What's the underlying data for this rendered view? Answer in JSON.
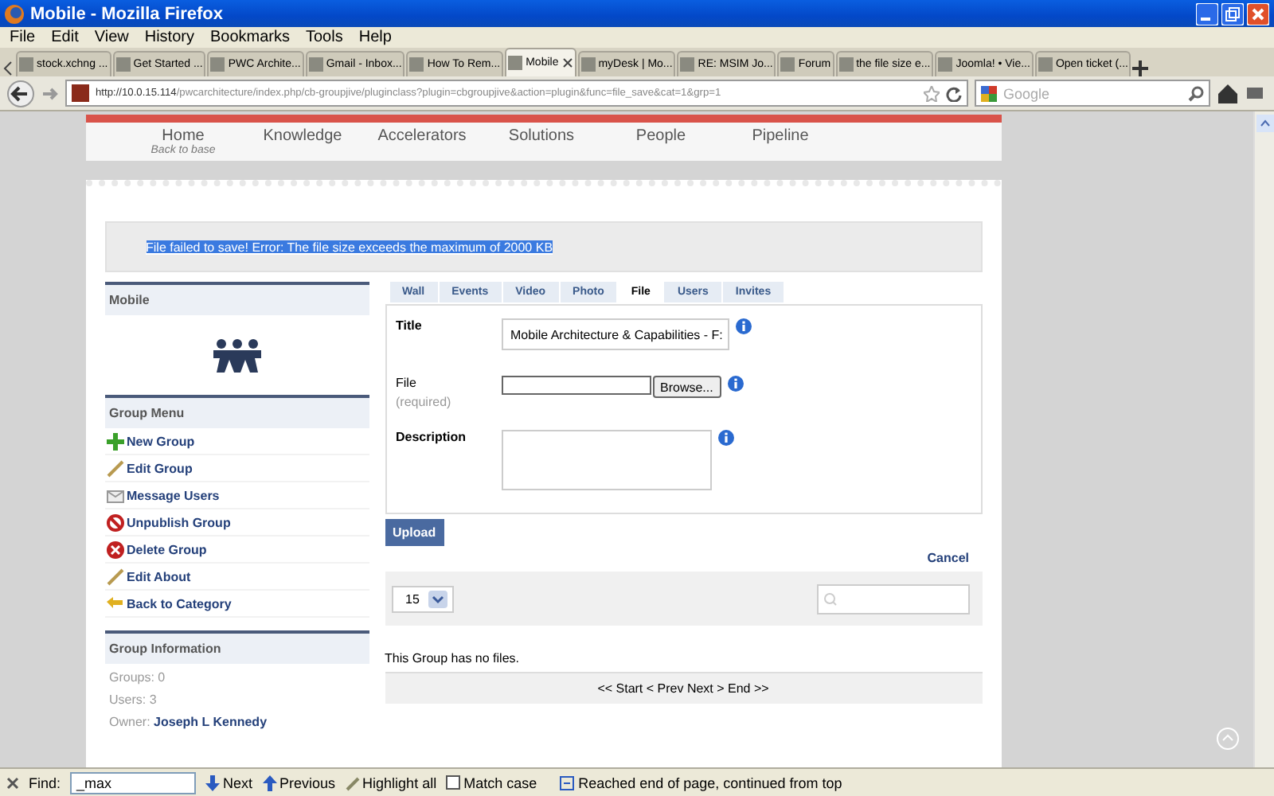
{
  "window": {
    "title": "Mobile - Mozilla Firefox"
  },
  "menu": [
    "File",
    "Edit",
    "View",
    "History",
    "Bookmarks",
    "Tools",
    "Help"
  ],
  "tabs": [
    {
      "label": "stock.xchng ...",
      "selected": false
    },
    {
      "label": "Get Started ...",
      "selected": false
    },
    {
      "label": "PWC Archite...",
      "selected": false
    },
    {
      "label": "Gmail - Inbox...",
      "selected": false
    },
    {
      "label": "How To Rem...",
      "selected": false
    },
    {
      "label": "Mobile",
      "selected": true
    },
    {
      "label": "myDesk | Mo...",
      "selected": false
    },
    {
      "label": "RE: MSIM Jo...",
      "selected": false
    },
    {
      "label": "Forum",
      "selected": false
    },
    {
      "label": "the file size e...",
      "selected": false
    },
    {
      "label": "Joomla! • Vie...",
      "selected": false
    },
    {
      "label": "Open ticket (...",
      "selected": false
    }
  ],
  "address": {
    "host": "http://10.0.15.114",
    "path": "/pwcarchitecture/index.php/cb-groupjive/pluginclass?plugin=cbgroupjive&action=plugin&func=file_save&cat=1&grp=1"
  },
  "search": {
    "placeholder": "Google"
  },
  "site_nav": [
    {
      "label": "Home",
      "sub": "Back to base"
    },
    {
      "label": "Knowledge"
    },
    {
      "label": "Accelerators"
    },
    {
      "label": "Solutions"
    },
    {
      "label": "People"
    },
    {
      "label": "Pipeline"
    }
  ],
  "error": {
    "text": "File failed to save! Error: The file size exceeds the maximum of 2000 KB",
    "highlighted": true
  },
  "group_panel": {
    "title": "Mobile"
  },
  "group_menu": {
    "title": "Group Menu",
    "items": [
      {
        "label": "New Group",
        "kind": "new"
      },
      {
        "label": "Edit Group",
        "kind": "edit"
      },
      {
        "label": "Message Users",
        "kind": "message"
      },
      {
        "label": "Unpublish Group",
        "kind": "unpublish"
      },
      {
        "label": "Delete Group",
        "kind": "delete"
      },
      {
        "label": "Edit About",
        "kind": "edit"
      },
      {
        "label": "Back to Category",
        "kind": "back"
      }
    ]
  },
  "group_info": {
    "title": "Group Information",
    "lines": [
      "Groups: 0",
      "Users: 3"
    ],
    "owner_label": "Owner:",
    "owner": "Joseph L Kennedy"
  },
  "content_tabs": [
    {
      "label": "Wall",
      "selected": false
    },
    {
      "label": "Events",
      "selected": false
    },
    {
      "label": "Video",
      "selected": false
    },
    {
      "label": "Photo",
      "selected": false
    },
    {
      "label": "File",
      "selected": true
    },
    {
      "label": "Users",
      "selected": false
    },
    {
      "label": "Invites",
      "selected": false
    }
  ],
  "form": {
    "fields": [
      {
        "kind": "text",
        "label": "Title",
        "value": "Mobile Architecture & Capabilities - F:"
      },
      {
        "kind": "file",
        "label": "File",
        "note": "(required)",
        "button": "Browse..."
      },
      {
        "kind": "textarea",
        "label": "Description"
      }
    ],
    "submit": "Upload",
    "cancel": "Cancel"
  },
  "list": {
    "page_size": "15",
    "empty": "This Group has no files.",
    "pagination": "<< Start < Prev Next > End >>"
  },
  "find_bar": {
    "label": "Find:",
    "value": "_max",
    "next": "Next",
    "previous": "Previous",
    "highlight_all": "Highlight all",
    "match_case": {
      "label": "Match case",
      "checked": false
    },
    "status": "Reached end of page, continued from top"
  }
}
